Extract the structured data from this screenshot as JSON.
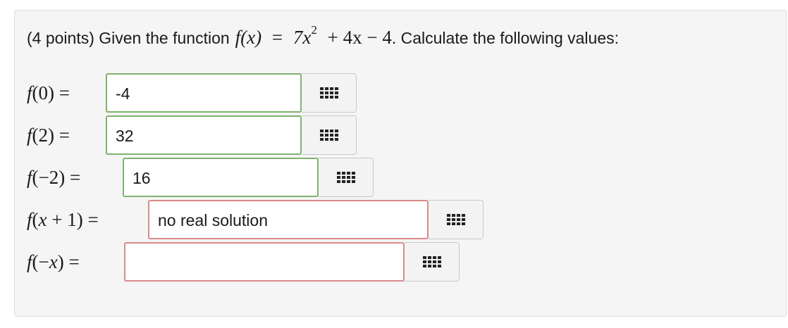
{
  "question": {
    "prefix": "(4 points) Given the function",
    "func_label": "f(x)",
    "equals": "=",
    "poly_coef": "7x",
    "poly_exp": "2",
    "poly_rest": "+ 4x − 4",
    "suffix": ". Calculate the following values:"
  },
  "rows": [
    {
      "label": "f(0) =",
      "value": "-4",
      "status": "correct"
    },
    {
      "label": "f(2) =",
      "value": "32",
      "status": "correct"
    },
    {
      "label": "f(−2) =",
      "value": "16",
      "status": "correct"
    },
    {
      "label": "f(x + 1) =",
      "value": "no real solution",
      "status": "incorrect"
    },
    {
      "label": "f(−x) =",
      "value": "",
      "status": "incorrect"
    }
  ],
  "keyboard_icon": "grid-keypad-icon"
}
